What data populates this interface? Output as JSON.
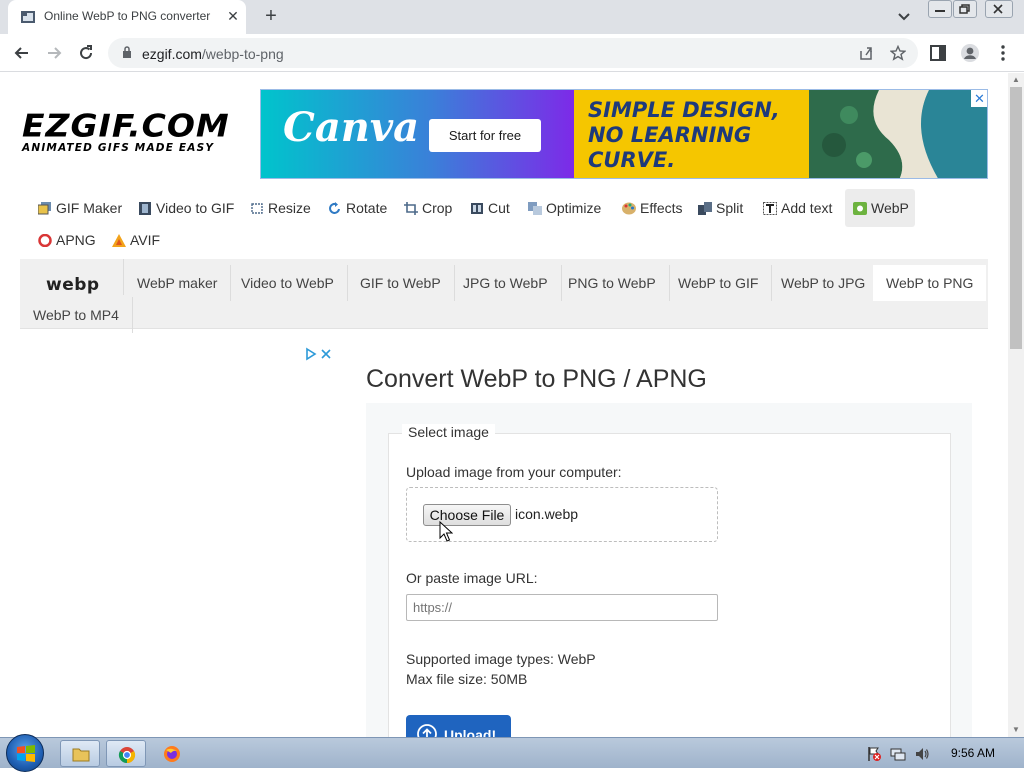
{
  "browser": {
    "tab_title": "Online WebP to PNG converter",
    "url_domain": "ezgif.com",
    "url_path": "/webp-to-png"
  },
  "site": {
    "logo_main": "EZGIF.COM",
    "logo_sub": "ANIMATED GIFS MADE EASY"
  },
  "ad": {
    "brand": "Canva",
    "cta": "Start for free",
    "headline": "SIMPLE DESIGN, NO LEARNING CURVE.",
    "close": "✕"
  },
  "main_menu": [
    {
      "label": "GIF Maker",
      "icon": "gif-maker-icon"
    },
    {
      "label": "Video to GIF",
      "icon": "film-icon"
    },
    {
      "label": "Resize",
      "icon": "resize-icon"
    },
    {
      "label": "Rotate",
      "icon": "rotate-icon"
    },
    {
      "label": "Crop",
      "icon": "crop-icon"
    },
    {
      "label": "Cut",
      "icon": "cut-icon"
    },
    {
      "label": "Optimize",
      "icon": "optimize-icon"
    },
    {
      "label": "Effects",
      "icon": "palette-icon"
    },
    {
      "label": "Split",
      "icon": "split-icon"
    },
    {
      "label": "Add text",
      "icon": "text-icon"
    },
    {
      "label": "WebP",
      "icon": "webp-icon",
      "active": true
    },
    {
      "label": "APNG",
      "icon": "apng-icon"
    },
    {
      "label": "AVIF",
      "icon": "avif-icon"
    }
  ],
  "sub_menu": {
    "logo": "webp",
    "items": [
      {
        "label": "WebP maker"
      },
      {
        "label": "Video to WebP"
      },
      {
        "label": "GIF to WebP"
      },
      {
        "label": "JPG to WebP"
      },
      {
        "label": "PNG to WebP"
      },
      {
        "label": "WebP to GIF"
      },
      {
        "label": "WebP to JPG"
      },
      {
        "label": "WebP to PNG",
        "active": true
      },
      {
        "label": "WebP to MP4"
      }
    ]
  },
  "content": {
    "title": "Convert WebP to PNG / APNG",
    "legend": "Select image",
    "upload_label": "Upload image from your computer:",
    "choose_file": "Choose File",
    "file_name": "icon.webp",
    "url_label": "Or paste image URL:",
    "url_placeholder": "https://",
    "supported": "Supported image types: WebP",
    "max_size": "Max file size: 50MB",
    "upload_button": "Upload!"
  },
  "taskbar": {
    "time": "9:56 AM"
  },
  "colors": {
    "accent_blue": "#1f64bf",
    "ad_yellow": "#f5c600",
    "ad_text": "#1e3a7b"
  }
}
